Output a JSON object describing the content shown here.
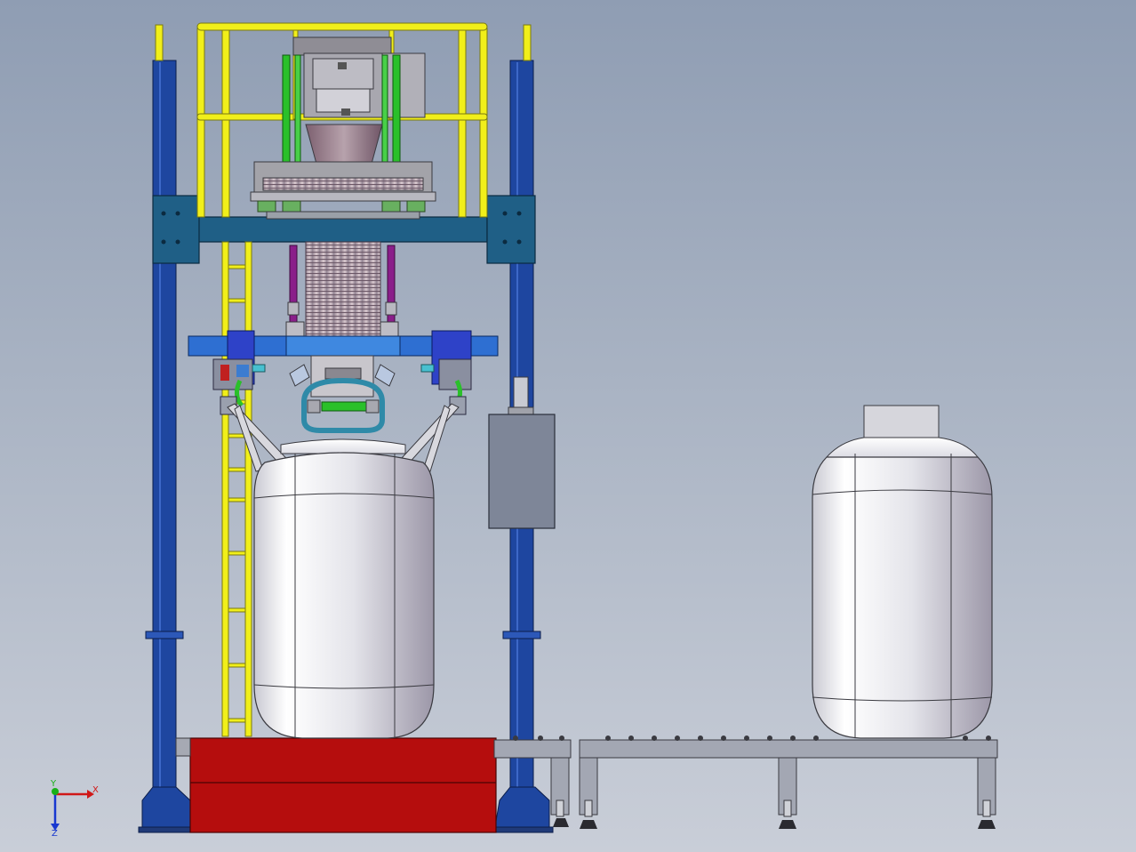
{
  "viewport": {
    "background_top": "#8f9db3",
    "background_bottom": "#c9ced8"
  },
  "triad": {
    "x_label": "X",
    "y_label": "Y",
    "z_label": "Z",
    "x_color": "#d01818",
    "y_color": "#18b018",
    "z_color": "#1838d0"
  },
  "colors": {
    "frame_blue": "#1e46a0",
    "frame_teal": "#1f5f86",
    "rail_yellow": "#f1ef1a",
    "base_red": "#b50d0d",
    "bag_white": "#e9e9ee",
    "conveyor_gray": "#a3a7b3",
    "control_box": "#7e8698",
    "cylinder_purple": "#8a1e8a",
    "pipe_green": "#2ac02a"
  }
}
